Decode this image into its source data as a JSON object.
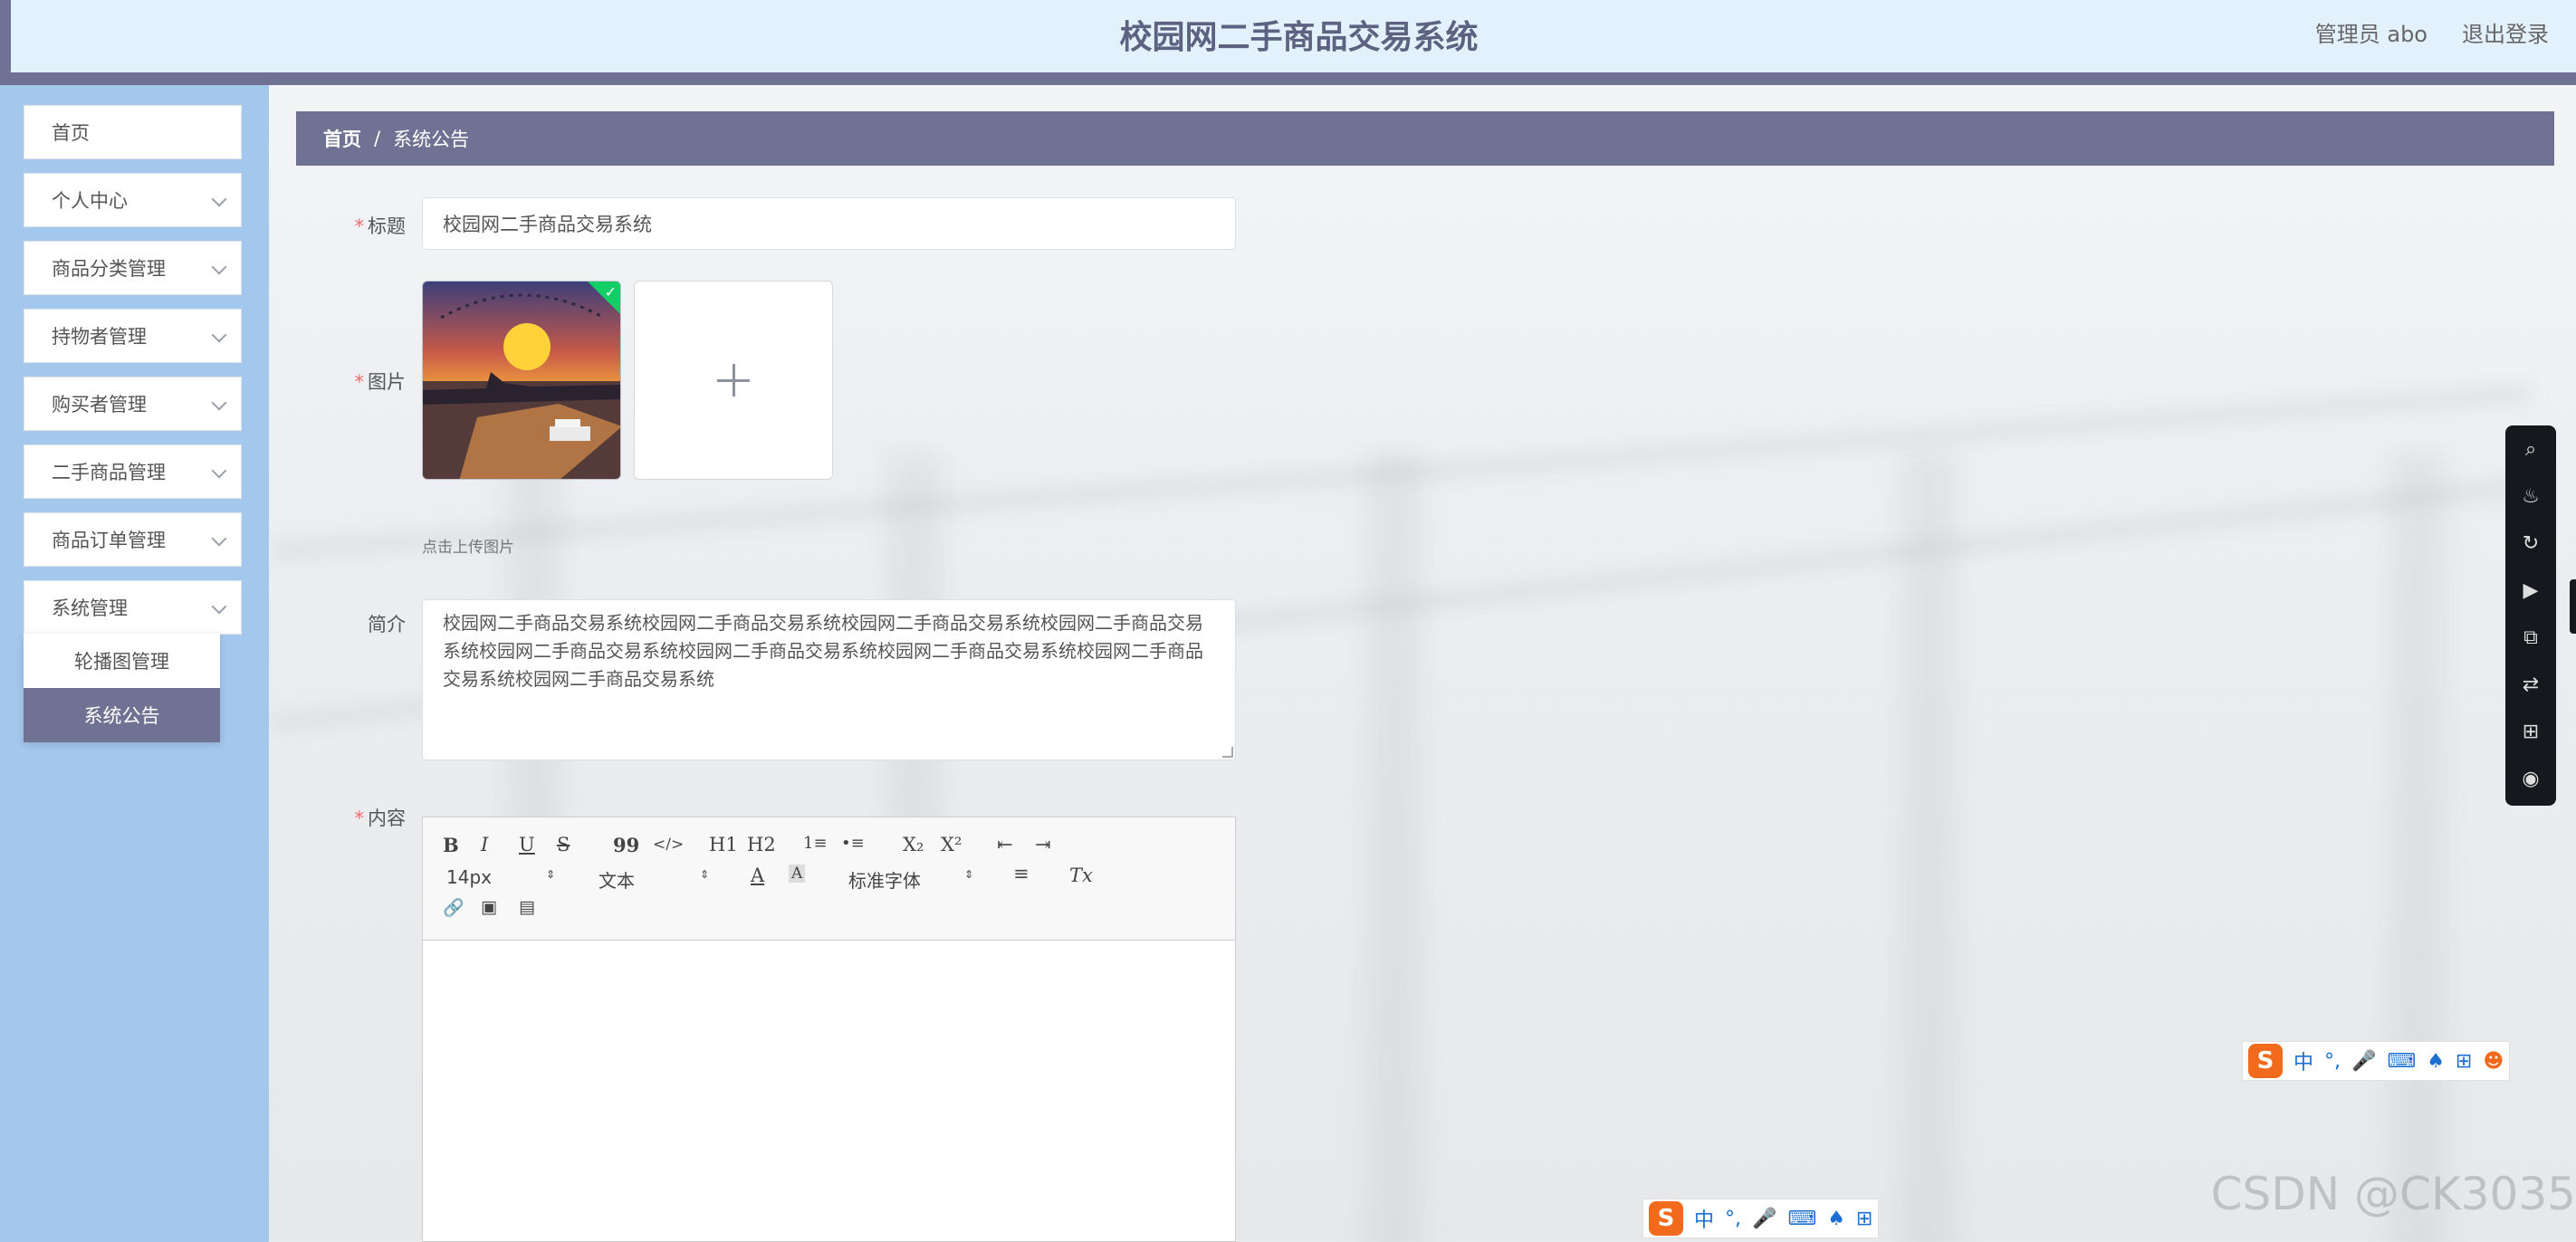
{
  "header": {
    "title": "校园网二手商品交易系统",
    "user": "管理员 abo",
    "logout": "退出登录"
  },
  "sidebar": {
    "items": [
      {
        "label": "首页"
      },
      {
        "label": "个人中心"
      },
      {
        "label": "商品分类管理"
      },
      {
        "label": "持物者管理"
      },
      {
        "label": "购买者管理"
      },
      {
        "label": "二手商品管理"
      },
      {
        "label": "商品订单管理"
      },
      {
        "label": "系统管理"
      }
    ],
    "submenu": [
      {
        "label": "轮播图管理"
      },
      {
        "label": "系统公告",
        "active": true
      }
    ]
  },
  "breadcrumb": {
    "home": "首页",
    "separator": "/",
    "current": "系统公告"
  },
  "form": {
    "required_mark": "*",
    "title_label": "标题",
    "title_value": "校园网二手商品交易系统",
    "image_label": "图片",
    "upload_tip": "点击上传图片",
    "intro_label": "简介",
    "intro_value": "校园网二手商品交易系统校园网二手商品交易系统校园网二手商品交易系统校园网二手商品交易系统校园网二手商品交易系统校园网二手商品交易系统校园网二手商品交易系统校园网二手商品交易系统校园网二手商品交易系统",
    "content_label": "内容"
  },
  "editor": {
    "buttons": [
      "B",
      "I",
      "U",
      "S",
      "99",
      "</>",
      "H1",
      "H2",
      "1≡",
      "•≡",
      "X₂",
      "X²",
      "⇤",
      "⇥"
    ],
    "font_size": "14px",
    "header_select": "文本",
    "font_family": "标准字体",
    "clean_label": "Tx"
  },
  "ime": {
    "logo": "S",
    "mode": "中",
    "punct": "°,"
  },
  "watermark": "CSDN @CK3035",
  "colors": {
    "primary": "#6f7293",
    "sidebar": "#a4c7ec",
    "header": "#e3f1fc",
    "required": "#f56c6c",
    "success": "#13ce66"
  }
}
